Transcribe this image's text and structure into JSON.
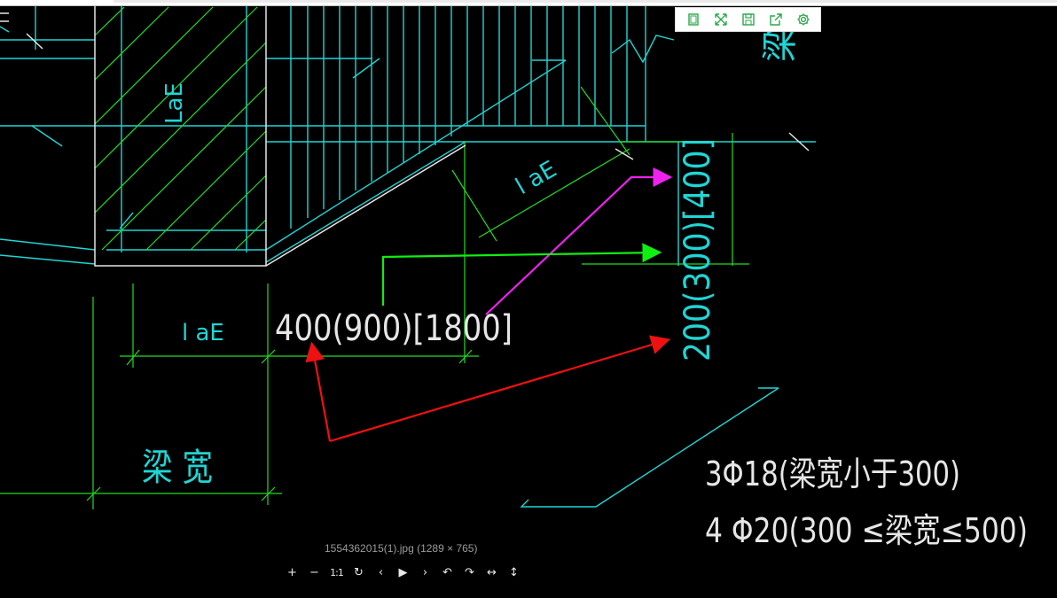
{
  "viewer": {
    "caption": "1554362015(1).jpg (1289 × 765)",
    "toolbar": [
      {
        "name": "fit-window-icon",
        "icon": "window"
      },
      {
        "name": "fullscreen-icon",
        "icon": "expand"
      },
      {
        "name": "save-icon",
        "icon": "floppy"
      },
      {
        "name": "share-icon",
        "icon": "share"
      },
      {
        "name": "settings-icon",
        "icon": "gear"
      }
    ],
    "nav": [
      {
        "name": "zoom-in-button",
        "label": "+"
      },
      {
        "name": "zoom-out-button",
        "label": "−"
      },
      {
        "name": "actual-size-button",
        "label": "1:1"
      },
      {
        "name": "reset-button",
        "label": "↻"
      },
      {
        "name": "previous-button",
        "label": "‹"
      },
      {
        "name": "play-button",
        "label": "▶"
      },
      {
        "name": "next-button",
        "label": "›"
      },
      {
        "name": "rotate-left-button",
        "label": "↶"
      },
      {
        "name": "rotate-right-button",
        "label": "↷"
      },
      {
        "name": "flip-horizontal-button",
        "label": "↔"
      },
      {
        "name": "flip-vertical-button",
        "label": "↕"
      }
    ]
  },
  "drawing": {
    "lae_label_top": "LaE",
    "lae_label_diag": "l aE",
    "lae_label_bottom": "l aE",
    "length_label": "400(900)[1800]",
    "height_label": "200(300)[400]",
    "beam_width_label": "梁 宽",
    "top_right_label": "梁",
    "rebar_line1": "3Φ18(梁宽小于300)",
    "rebar_line2": "4 Φ20(300 ≤梁宽≤500)",
    "colors": {
      "cyan": "#1fd5d5",
      "green": "#22dd22",
      "white": "#e6e6e6",
      "magenta": "#ee22ee",
      "red": "#ee1111",
      "neon_green": "#11ee11"
    }
  }
}
